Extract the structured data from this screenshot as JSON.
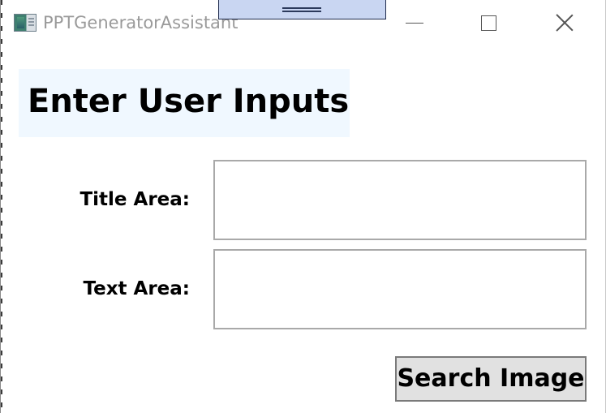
{
  "window": {
    "title": "PPTGeneratorAssistant",
    "icon": "app-icon",
    "controls": {
      "minimize_icon": "minimize-icon",
      "maximize_icon": "maximize-icon",
      "close_icon": "close-icon"
    }
  },
  "form": {
    "heading": "Enter User Inputs",
    "title_label": "Title Area:",
    "title_value": "",
    "text_label": "Text Area:",
    "text_value": "",
    "search_button_label": "Search Image"
  },
  "colors": {
    "heading_background": "#f0f8ff",
    "button_background": "#e1e1e1",
    "drag_handle": "#c9d6f2"
  }
}
